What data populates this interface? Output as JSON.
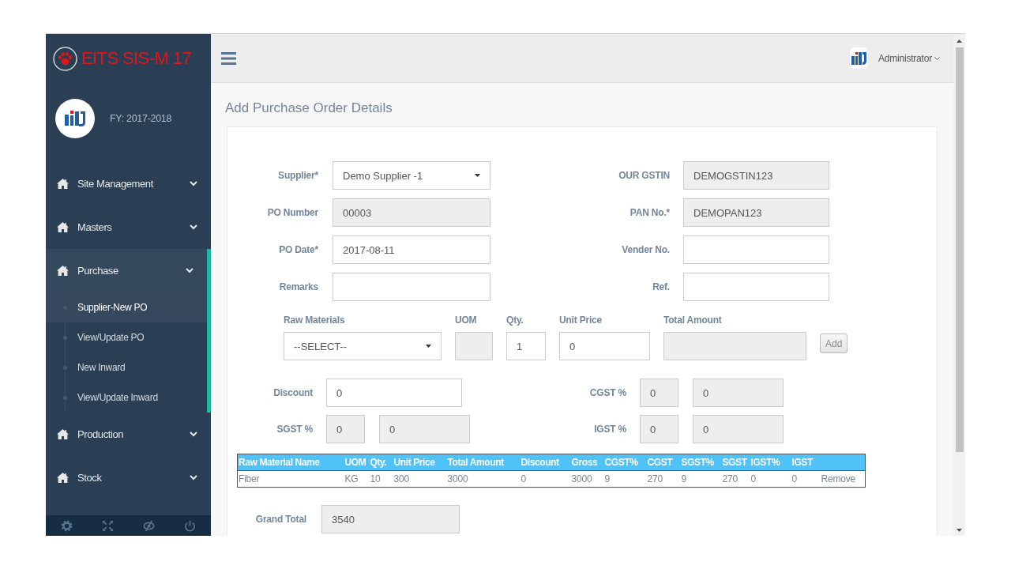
{
  "sidebar": {
    "brand": "EITS SIS-M 17",
    "fiscal_year": "FY: 2017-2018",
    "menu": [
      {
        "label": "Site Management",
        "selected": false
      },
      {
        "label": "Masters",
        "selected": false
      },
      {
        "label": "Purchase",
        "selected": true,
        "children": [
          {
            "label": "Supplier-New PO",
            "selected": true
          },
          {
            "label": "View/Update PO",
            "selected": false
          },
          {
            "label": "New Inward",
            "selected": false
          },
          {
            "label": "View/Update Inward",
            "selected": false
          }
        ]
      },
      {
        "label": "Production",
        "selected": false
      },
      {
        "label": "Stock",
        "selected": false
      }
    ]
  },
  "top_bar": {
    "user": "Administrator"
  },
  "page": {
    "title": "Add Purchase Order Details"
  },
  "form": {
    "left_fields": [
      {
        "label": "Supplier*",
        "kind": "select",
        "value": "Demo Supplier -1"
      },
      {
        "label": "PO Number",
        "kind": "readonly",
        "value": "00003"
      },
      {
        "label": "PO Date*",
        "kind": "text",
        "value": "2017-08-11"
      },
      {
        "label": "Remarks",
        "kind": "text"
      }
    ],
    "right_fields": [
      {
        "label": "OUR GSTIN",
        "kind": "readonly",
        "value": "DEMOGSTIN123"
      },
      {
        "label": "PAN No.*",
        "kind": "readonly",
        "value": "DEMOPAN123"
      },
      {
        "label": "Vender No.",
        "kind": "text"
      },
      {
        "label": "Ref.",
        "kind": "text"
      }
    ]
  },
  "item_entry": {
    "fields": [
      {
        "label": "Raw Materials",
        "kind": "select",
        "value": "--SELECT--"
      },
      {
        "label": "UOM",
        "kind": "readonly"
      },
      {
        "label": "Qty.",
        "kind": "text",
        "value": "1"
      },
      {
        "label": "Unit Price",
        "kind": "text",
        "value": "0"
      },
      {
        "label": "Total Amount",
        "kind": "readonly"
      }
    ],
    "add_button": "Add"
  },
  "tax_fields": [
    {
      "label": "Discount",
      "inputs": [
        {
          "kind": "text",
          "value": "0"
        }
      ]
    },
    {
      "label": "CGST %",
      "inputs": [
        {
          "kind": "readonly",
          "value": "0"
        },
        {
          "kind": "readonly",
          "value": "0"
        }
      ]
    },
    {
      "label": "SGST %",
      "inputs": [
        {
          "kind": "readonly",
          "value": "0"
        },
        {
          "kind": "readonly",
          "value": "0"
        }
      ]
    },
    {
      "label": "IGST %",
      "inputs": [
        {
          "kind": "readonly",
          "value": "0"
        },
        {
          "kind": "readonly",
          "value": "0"
        }
      ]
    }
  ],
  "items_table": {
    "columns": [
      "Raw Material Name",
      "UOM",
      "Qty.",
      "Unit Price",
      "Total Amount",
      "Discount",
      "Gross",
      "CGST%",
      "CGST",
      "SGST%",
      "SGST",
      "IGST%",
      "IGST"
    ],
    "rows": [
      {
        "cells": [
          "Fiber",
          "KG",
          "10",
          "300",
          "3000",
          "0",
          "3000",
          "9",
          "270",
          "9",
          "270",
          "0",
          "0"
        ],
        "action": "Remove"
      }
    ]
  },
  "grand_total": {
    "label": "Grand Total",
    "value": "3540"
  }
}
